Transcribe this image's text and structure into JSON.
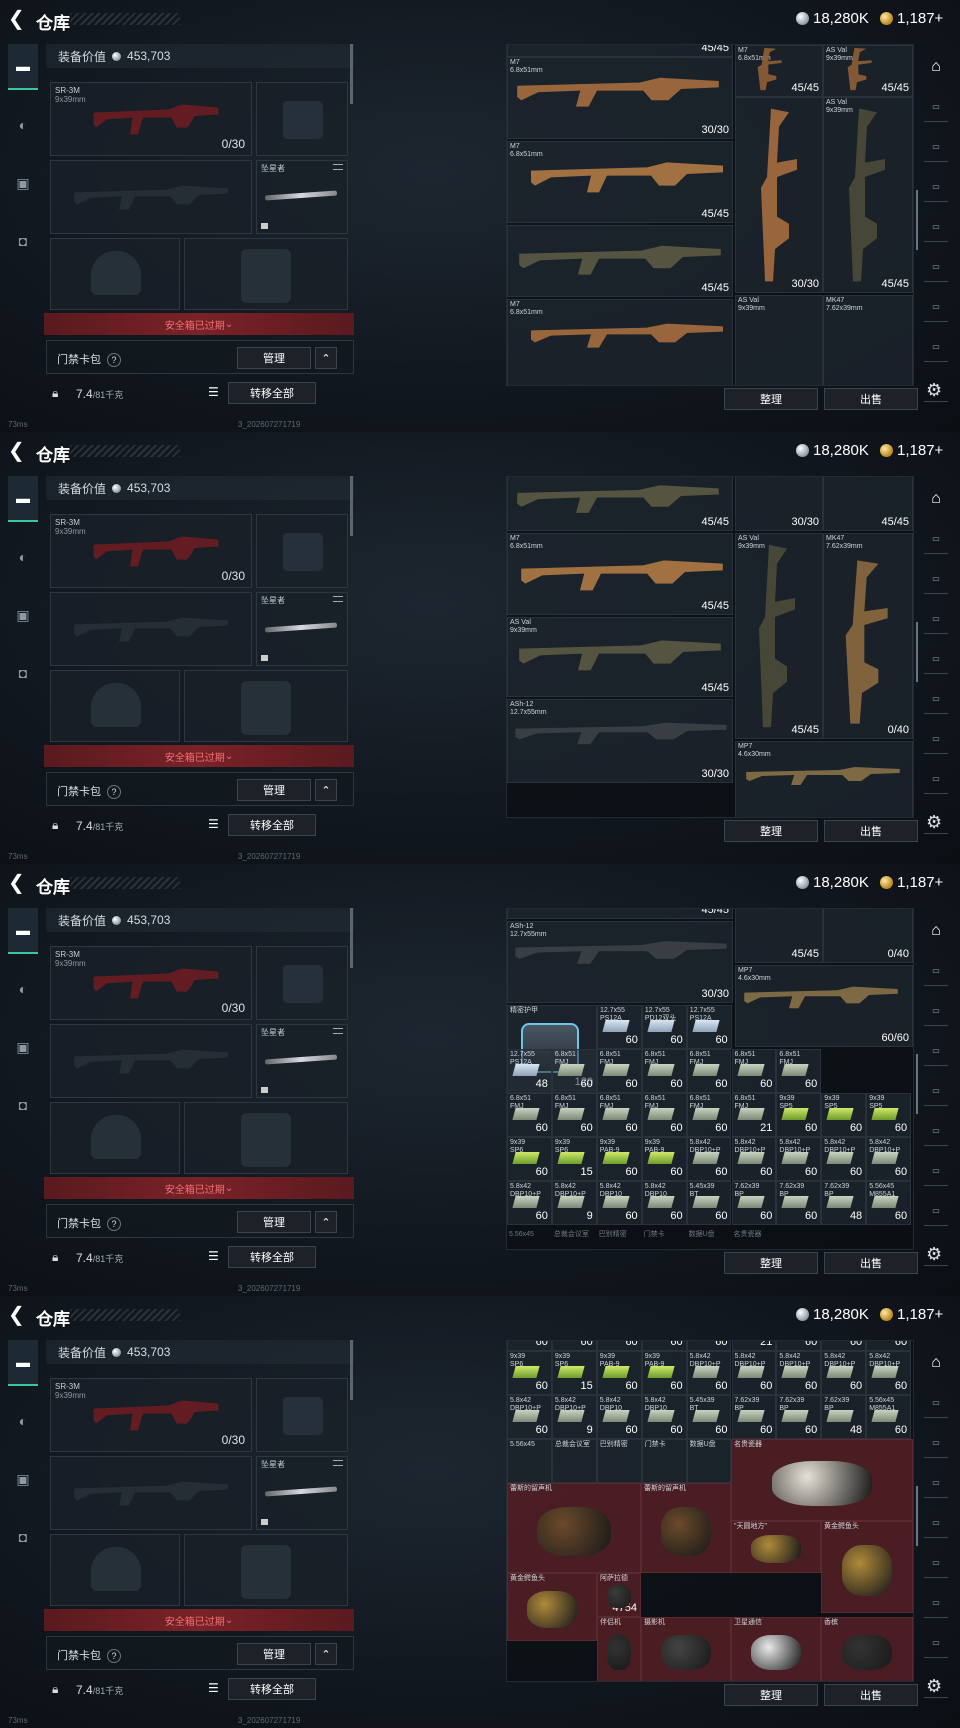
{
  "header": {
    "title": "仓库",
    "silver": "18,280K",
    "gold": "1,187+"
  },
  "loadout": {
    "value_label": "装备价值",
    "value": "453,703",
    "primary": {
      "name": "SR-3M",
      "caliber": "9x39mm",
      "ammo": "0/30"
    },
    "melee_label": "坠星者",
    "safe_box_expired": "安全箱已过期",
    "keycard_label": "门禁卡包",
    "keycard_help": "?",
    "manage_button": "管理",
    "weight": "7.4",
    "weight_max": "/81千克",
    "transfer_all_button": "转移全部"
  },
  "stash": {
    "sort_button": "整理",
    "sell_button": "出售"
  },
  "status": {
    "ping": "73ms",
    "version": "3_202607271719"
  },
  "frames": [
    {
      "cells": [
        {
          "label": "",
          "count": "45/45"
        },
        {
          "label": "M7\n6.8x51mm",
          "count": "30/30"
        },
        {
          "label": "M7\n6.8x51mm",
          "count": "45/45"
        },
        {
          "label": "M7\n6.8x51mm",
          "count": "45/45"
        },
        {
          "label": "AS Val\n9x39mm",
          "count": "45/45"
        },
        {
          "label": "",
          "count": "30/30"
        },
        {
          "label": "AS Val\n9x39mm",
          "count": "45/45"
        },
        {
          "label": "",
          "count": "45/45"
        },
        {
          "label": "M7\n6.8x51mm",
          "count": ""
        },
        {
          "label": "AS Val\n9x39mm",
          "count": ""
        },
        {
          "label": "MK47\n7.62x39mm",
          "count": ""
        }
      ]
    },
    {
      "cells": [
        {
          "label": "",
          "count": "45/45"
        },
        {
          "label": "",
          "count": "30/30"
        },
        {
          "label": "",
          "count": "45/45"
        },
        {
          "label": "M7\n6.8x51mm",
          "count": "45/45"
        },
        {
          "label": "AS Val\n9x39mm",
          "count": "45/45"
        },
        {
          "label": "MK47\n7.62x39mm",
          "count": "0/40"
        },
        {
          "label": "AS Val\n9x39mm",
          "count": "45/45"
        },
        {
          "label": "ASh-12\n12.7x55mm",
          "count": "30/30"
        },
        {
          "label": "MP7\n4.6x30mm",
          "count": ""
        }
      ]
    },
    {
      "top_cells": [
        {
          "label": "",
          "count": "45/45"
        },
        {
          "label": "",
          "count": "45/45"
        },
        {
          "label": "",
          "count": "0/40"
        },
        {
          "label": "ASh-12\n12.7x55mm",
          "count": "30/30"
        },
        {
          "label": "MP7\n4.6x30mm",
          "count": "60/60"
        },
        {
          "label": "精密护甲",
          "count": "120"
        }
      ],
      "ammo_rows": [
        [
          {
            "l": "12.7x55\nPS12A",
            "c": "60"
          },
          {
            "l": "12.7x55\nPD12双头",
            "c": "60"
          },
          {
            "l": "12.7x55\nPS12A",
            "c": "60"
          }
        ],
        [
          {
            "l": "12.7x55\nPS12A",
            "c": "48"
          },
          {
            "l": "6.8x51\nFMJ",
            "c": "60"
          },
          {
            "l": "6.8x51\nFMJ",
            "c": "60"
          },
          {
            "l": "6.8x51\nFMJ",
            "c": "60"
          },
          {
            "l": "6.8x51\nFMJ",
            "c": "60"
          },
          {
            "l": "6.8x51\nFMJ",
            "c": "60"
          },
          {
            "l": "6.8x51\nFMJ",
            "c": "60"
          }
        ],
        [
          {
            "l": "6.8x51\nFMJ",
            "c": "60"
          },
          {
            "l": "6.8x51\nFMJ",
            "c": "60"
          },
          {
            "l": "6.8x51\nFMJ",
            "c": "60"
          },
          {
            "l": "6.8x51\nFMJ",
            "c": "60"
          },
          {
            "l": "6.8x51\nFMJ",
            "c": "60"
          },
          {
            "l": "6.8x51\nFMJ",
            "c": "21"
          },
          {
            "l": "9x39\nSP5",
            "c": "60"
          },
          {
            "l": "9x39\nSP5",
            "c": "60"
          },
          {
            "l": "9x39\nSP5",
            "c": "60"
          }
        ],
        [
          {
            "l": "9x39\nSP6",
            "c": "60"
          },
          {
            "l": "9x39\nSP6",
            "c": "15"
          },
          {
            "l": "9x39\nPAB-9",
            "c": "60"
          },
          {
            "l": "9x39\nPAB-9",
            "c": "60"
          },
          {
            "l": "5.8x42\nDBP10+P",
            "c": "60"
          },
          {
            "l": "5.8x42\nDBP10+P",
            "c": "60"
          },
          {
            "l": "5.8x42\nDBP10+P",
            "c": "60"
          },
          {
            "l": "5.8x42\nDBP10+P",
            "c": "60"
          },
          {
            "l": "5.8x42\nDBP10+P",
            "c": "60"
          }
        ],
        [
          {
            "l": "5.8x42\nDBP10+P",
            "c": "60"
          },
          {
            "l": "5.8x42\nDBP10+P",
            "c": "9"
          },
          {
            "l": "5.8x42\nDBP10",
            "c": "60"
          },
          {
            "l": "5.8x42\nDBP10",
            "c": "60"
          },
          {
            "l": "5.45x39\nBT",
            "c": "60"
          },
          {
            "l": "7.62x39\nBP",
            "c": "60"
          },
          {
            "l": "7.62x39\nBP",
            "c": "60"
          },
          {
            "l": "7.62x39\nBP",
            "c": "48"
          },
          {
            "l": "5.56x45\nM855A1",
            "c": "60"
          }
        ]
      ],
      "bottom_labels": [
        "5.56x45",
        "总裁会议室",
        "巴别精密",
        "门禁卡",
        "数据U盘",
        "名贵瓷器"
      ]
    },
    {
      "treasures": [
        {
          "label": "蕾斯的留声机",
          "count": ""
        },
        {
          "label": "蕾斯的留声机",
          "count": ""
        },
        {
          "label": "名贵瓷器",
          "count": ""
        },
        {
          "label": "\"天圆地方\"",
          "count": ""
        },
        {
          "label": "黄金鳄鱼头",
          "count": ""
        },
        {
          "label": "黄金鳄鱼头",
          "count": ""
        },
        {
          "label": "阿萨拉德",
          "count": "4754"
        },
        {
          "label": "摄影机",
          "count": ""
        },
        {
          "label": "卫星通信",
          "count": ""
        },
        {
          "label": "香槟",
          "count": ""
        },
        {
          "label": "伴侣机",
          "count": ""
        }
      ]
    }
  ],
  "colors": {
    "accent": "#39c6a4",
    "danger": "#7a2228",
    "bg": "#121820"
  },
  "icons": [
    "back-arrow-icon",
    "silver-coin-icon",
    "gold-coin-icon",
    "pistol-icon",
    "helmet-icon",
    "vest-icon",
    "backpack-icon",
    "lock-icon",
    "list-icon",
    "chevron-up-icon",
    "swap-icon",
    "gear-icon",
    "team-icon"
  ]
}
